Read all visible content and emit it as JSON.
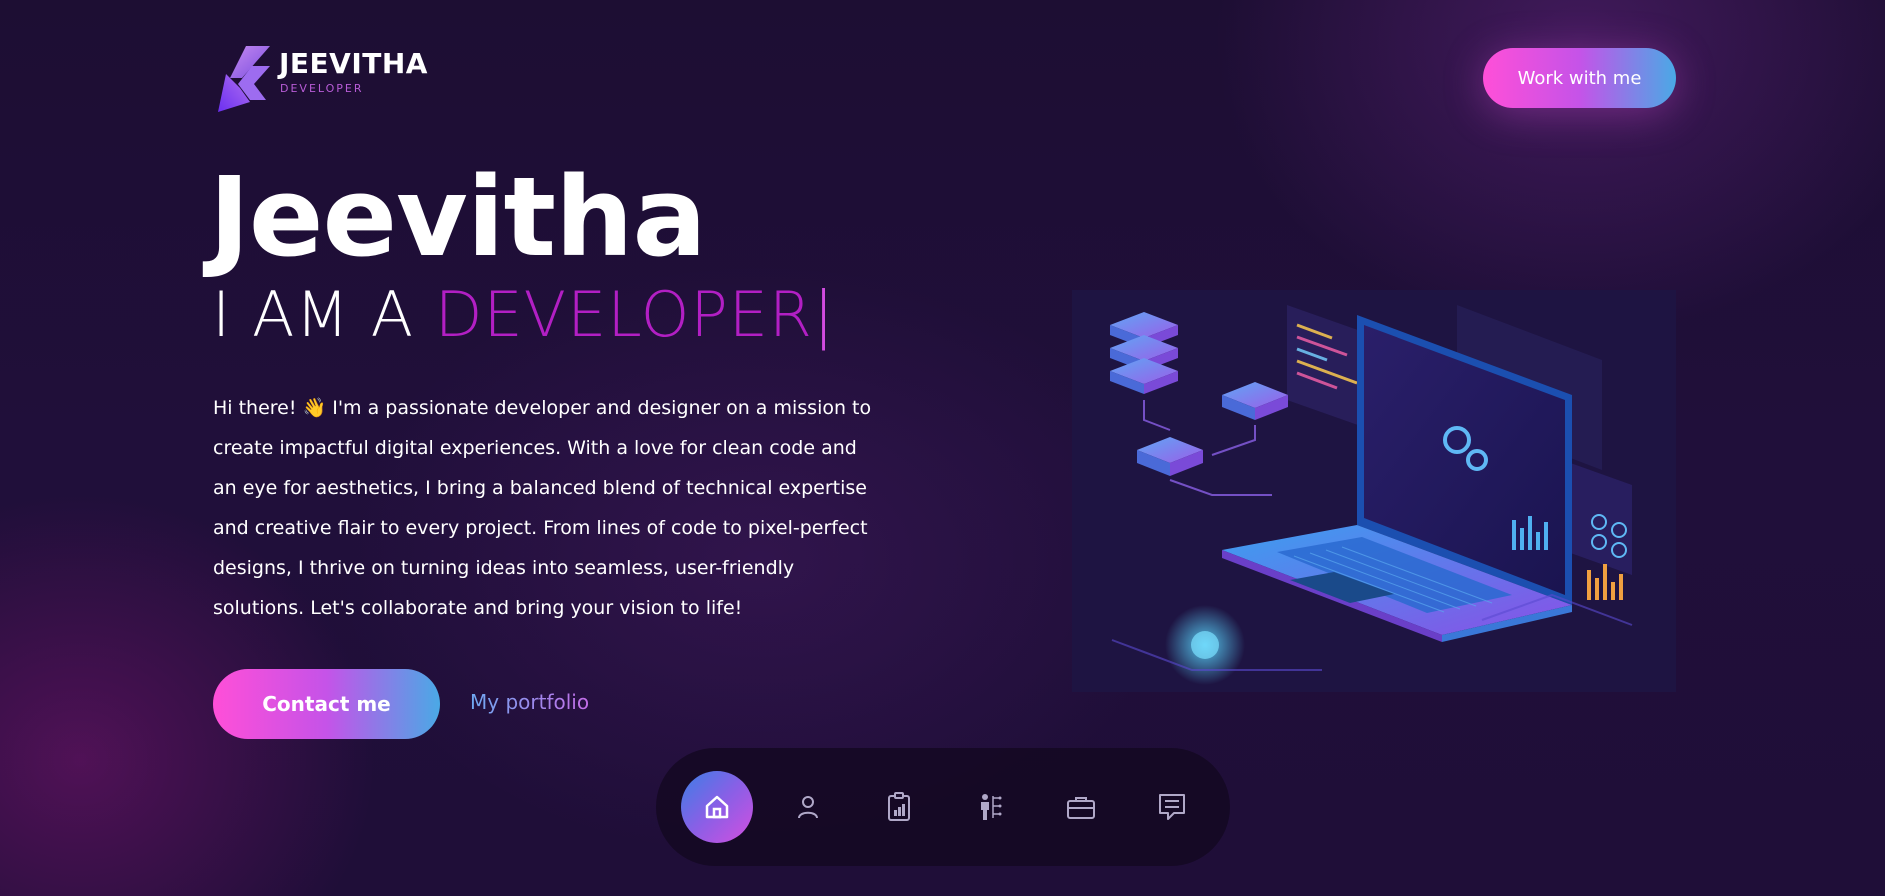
{
  "header": {
    "logo_name": "JEEVITHA",
    "logo_subtitle": "DEVELOPER",
    "logo_icon": "arrow-logo-icon",
    "cta_label": "Work with me"
  },
  "hero": {
    "name": "Jeevitha",
    "role_prefix": "I AM A ",
    "role_word": "DEVELOPER",
    "role_caret": "|",
    "description": "Hi there! 👋 I'm a passionate developer and designer on a mission to create impactful digital experiences. With a love for clean code and an eye for aesthetics, I bring a balanced blend of technical expertise and creative flair to every project. From lines of code to pixel-perfect designs, I thrive on turning ideas into seamless, user-friendly solutions. Let's collaborate and bring your vision to life!",
    "contact_label": "Contact me",
    "portfolio_label": "My portfolio",
    "illustration": "isometric-laptop-illustration"
  },
  "nav": {
    "items": [
      {
        "icon": "home-icon",
        "active": true
      },
      {
        "icon": "user-icon",
        "active": false
      },
      {
        "icon": "clipboard-chart-icon",
        "active": false
      },
      {
        "icon": "presenter-icon",
        "active": false
      },
      {
        "icon": "briefcase-icon",
        "active": false
      },
      {
        "icon": "message-icon",
        "active": false
      }
    ]
  },
  "colors": {
    "background": "#1d0e33",
    "accent_pink": "#ff4fd8",
    "accent_blue": "#4aa9e6",
    "role_word": "#b21fc4",
    "logo_subtitle": "#b85cd6"
  }
}
